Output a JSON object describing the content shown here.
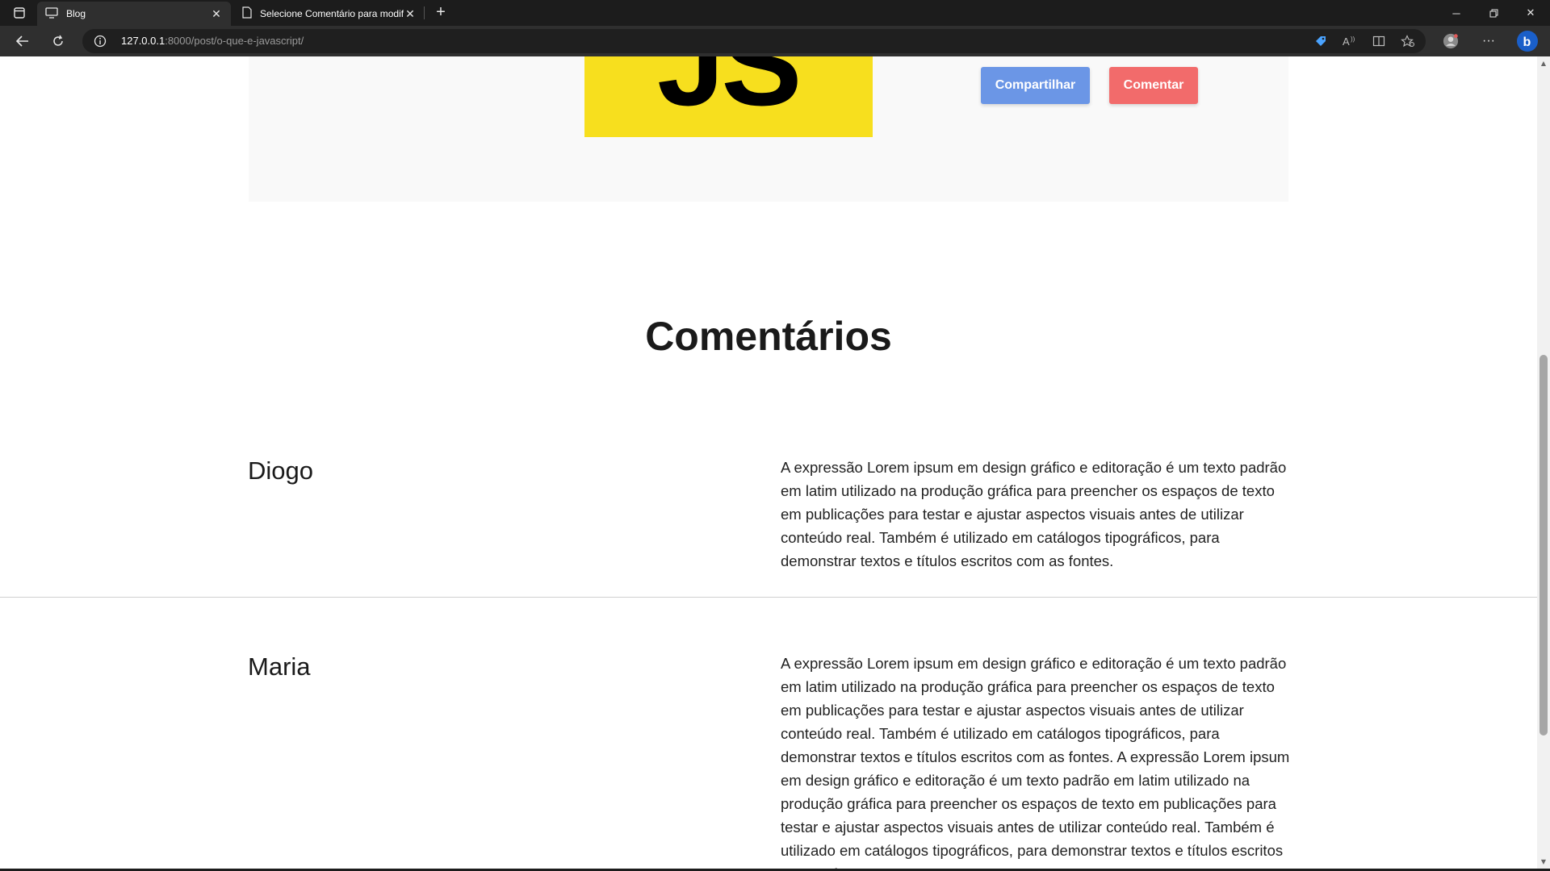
{
  "browser": {
    "tabs": [
      {
        "title": "Blog",
        "icon": "monitor-icon"
      },
      {
        "title": "Selecione Comentário para modificar",
        "icon": "document-icon"
      }
    ],
    "address_host": "127.0.0.1",
    "address_rest": ":8000/post/o-que-e-javascript/"
  },
  "post": {
    "logo_text": "JS",
    "share_label": "Compartilhar",
    "comment_label": "Comentar"
  },
  "comments_section": {
    "title": "Comentários",
    "items": [
      {
        "author": "Diogo",
        "text": "A expressão Lorem ipsum em design gráfico e editoração é um texto padrão em latim utilizado na produção gráfica para preencher os espaços de texto em publicações para testar e ajustar aspectos visuais antes de utilizar conteúdo real. Também é utilizado em catálogos tipográficos, para demonstrar textos e títulos escritos com as fontes."
      },
      {
        "author": "Maria",
        "text": "A expressão Lorem ipsum em design gráfico e editoração é um texto padrão em latim utilizado na produção gráfica para preencher os espaços de texto em publicações para testar e ajustar aspectos visuais antes de utilizar conteúdo real. Também é utilizado em catálogos tipográficos, para demonstrar textos e títulos escritos com as fontes. A expressão Lorem ipsum em design gráfico e editoração é um texto padrão em latim utilizado na produção gráfica para preencher os espaços de texto em publicações para testar e ajustar aspectos visuais antes de utilizar conteúdo real. Também é utilizado em catálogos tipográficos, para demonstrar textos e títulos escritos com as fontes."
      }
    ]
  },
  "colors": {
    "share_button": "#6b96e6",
    "comment_button": "#f26b6b",
    "js_logo": "#f7df1e"
  }
}
